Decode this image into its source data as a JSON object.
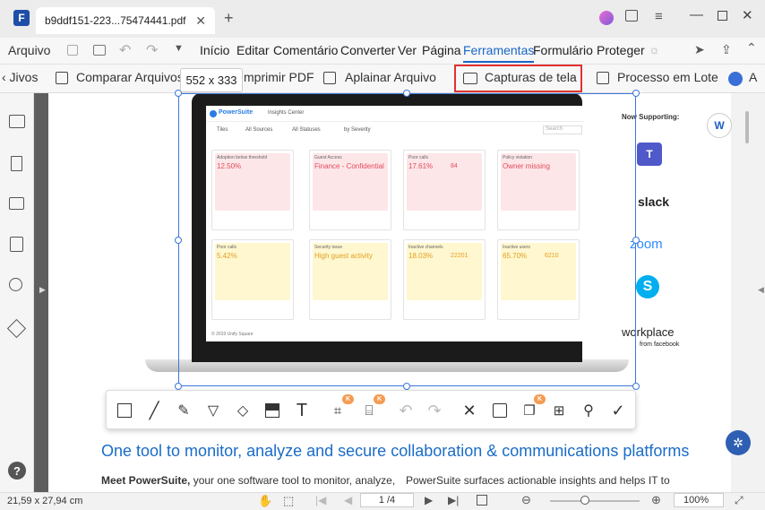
{
  "window": {
    "tab_title": "b9ddf151-223...75474441.pdf",
    "new_tab": "+"
  },
  "menu": {
    "items": [
      "Arquivo",
      "Início",
      "Editar",
      "Comentário",
      "Converter",
      "Ver",
      "Página",
      "Ferramentas",
      "Formulário",
      "Proteger"
    ],
    "active": "Ferramentas"
  },
  "toolbar": {
    "back_label": "‹ Jivos",
    "compare": "Comparar Arquivos",
    "print": "mprimir PDF",
    "flatten": "Aplainar Arquivo",
    "screenshot": "Capturas de tela",
    "batch": "Processo em Lote",
    "more": "A"
  },
  "selection": {
    "size_label": "552 x 333"
  },
  "screenshot_content": {
    "app_name": "PowerSuite",
    "center": "Insights Center",
    "filters": [
      "Tiles",
      "All Sources",
      "All Statuses",
      "by Severity"
    ],
    "search_placeholder": "Search",
    "cards": [
      {
        "title": "Adoption below threshold",
        "value": "12.50%",
        "color": "red"
      },
      {
        "title": "Guest Access",
        "value": "Finance - Confidential",
        "color": "red"
      },
      {
        "title": "Poor calls",
        "value": "17.61%",
        "value2": "84",
        "color": "red"
      },
      {
        "title": "Policy violation",
        "value": "Owner missing",
        "color": "red"
      },
      {
        "title": "Poor calls",
        "value": "5.42%",
        "color": "yellow"
      },
      {
        "title": "Security issue",
        "value": "High guest activity",
        "color": "yellow"
      },
      {
        "title": "Inactive channels",
        "value": "18.03%",
        "value2": "22201",
        "color": "yellow"
      },
      {
        "title": "Inactive users",
        "value": "65.70%",
        "value2": "6210",
        "color": "yellow"
      }
    ],
    "footer": "© 2019 Unify Square"
  },
  "side_brands": {
    "heading": "Now Supporting:",
    "brands": [
      "slack",
      "zoom",
      "workplace",
      "from facebook"
    ]
  },
  "document": {
    "heading": "One tool to monitor, analyze and secure collaboration & communications platforms",
    "para1_bold": "Meet PowerSuite,",
    "para1": " your one software tool to monitor, analyze,",
    "para2": "PowerSuite surfaces actionable insights and helps IT to"
  },
  "statusbar": {
    "page_size": "21,59 x 27,94 cm",
    "page_indicator": "1 /4",
    "zoom": "100%"
  },
  "colors": {
    "accent": "#3a78d8",
    "highlight_box": "#e0322f",
    "heading": "#1a6cc8",
    "badge": "#f59b52"
  }
}
